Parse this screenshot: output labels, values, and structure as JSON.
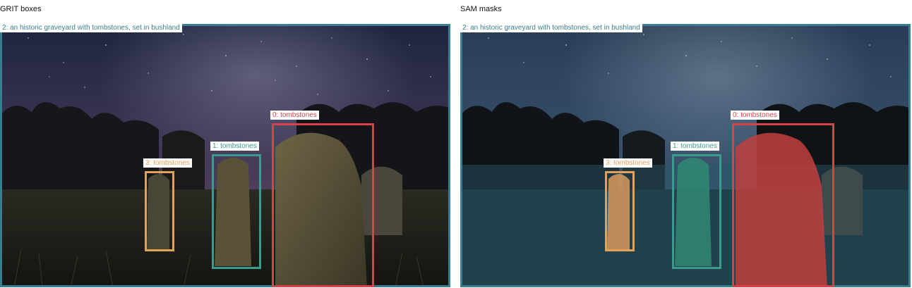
{
  "panels": [
    {
      "title": "GRIT boxes",
      "regions": [
        {
          "label": "2: an historic graveyard with tombstones, set in bushland",
          "color": "#3a7d8e"
        },
        {
          "label": "1: tombstones",
          "color": "#3a9b8e"
        },
        {
          "label": "3: tombstones",
          "color": "#e3a15a"
        },
        {
          "label": "0: tombstones",
          "color": "#d9414b"
        }
      ]
    },
    {
      "title": "SAM masks",
      "regions": [
        {
          "label": "2: an historic graveyard with tombstones, set in bushland",
          "color": "#3a7d8e"
        },
        {
          "label": "1: tombstones",
          "color": "#3a9b8e"
        },
        {
          "label": "3: tombstones",
          "color": "#e3a15a"
        },
        {
          "label": "0: tombstones",
          "color": "#d9414b"
        }
      ]
    }
  ]
}
